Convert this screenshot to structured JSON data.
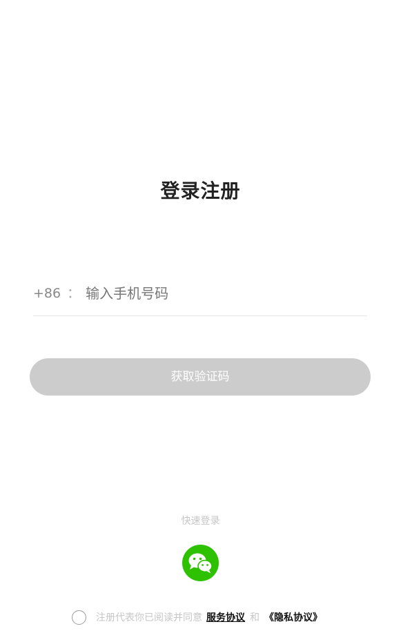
{
  "page": {
    "title": "登录注册"
  },
  "phone": {
    "country_code": "+86",
    "separator": "：",
    "value": "",
    "placeholder": "输入手机号码"
  },
  "actions": {
    "get_code_label": "获取验证码"
  },
  "quick_login": {
    "label": "快速登录",
    "wechat_icon": "wechat-icon",
    "wechat_color": "#2dc100"
  },
  "agreement": {
    "checked": false,
    "prefix_text": "注册代表你已阅读并同意",
    "service_link": "服务协议",
    "and_text": "和",
    "privacy_link": "《隐私协议》"
  },
  "colors": {
    "button_disabled": "#cccccc",
    "accent": "#2dc100"
  }
}
